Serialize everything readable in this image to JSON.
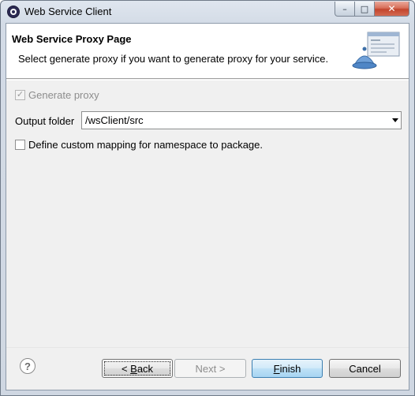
{
  "window": {
    "title": "Web Service Client",
    "controls": {
      "minimize": "–",
      "maximize": "□",
      "close": "✕"
    }
  },
  "banner": {
    "title": "Web Service Proxy Page",
    "description": "Select generate proxy if you want to generate proxy for your service.",
    "icon": "service-bell-icon"
  },
  "form": {
    "generate_proxy": {
      "label": "Generate proxy",
      "checked": true,
      "enabled": false
    },
    "output_folder": {
      "label": "Output folder",
      "value": "/wsClient/src"
    },
    "custom_mapping": {
      "label": "Define custom mapping for namespace to package.",
      "checked": false
    }
  },
  "footer": {
    "help": "?",
    "back": {
      "prefix": "< ",
      "mnemonic": "B",
      "rest": "ack"
    },
    "next": "Next >",
    "finish": {
      "mnemonic": "F",
      "rest": "inish"
    },
    "cancel": "Cancel"
  },
  "colors": {
    "window_frame": "#cfd7e2",
    "client": "#f0f0f0",
    "finish_accent": "#3c7fb1"
  }
}
